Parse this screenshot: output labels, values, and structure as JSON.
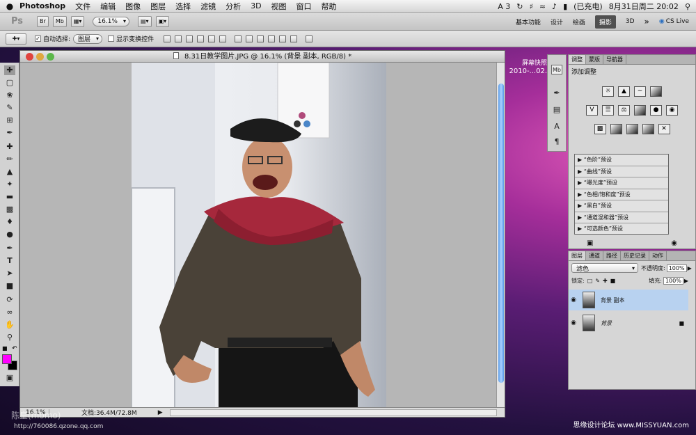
{
  "menubar": {
    "apple": "",
    "app": "Photoshop",
    "items": [
      "文件",
      "编辑",
      "图像",
      "图层",
      "选择",
      "滤镜",
      "分析",
      "3D",
      "视图",
      "窗口",
      "帮助"
    ],
    "status": {
      "a3": "A 3",
      "battery": "(已充电)",
      "datetime": "8月31日周二  20:02"
    }
  },
  "appbar": {
    "ps": "Ps",
    "br": "Br",
    "mb": "Mb",
    "zoom": "16.1%",
    "workspaces": [
      "基本功能",
      "设计",
      "绘画",
      "摄影",
      "3D"
    ],
    "active_workspace": "摄影",
    "more": "»",
    "cslive": "CS Live"
  },
  "options": {
    "auto_select_label": "自动选择:",
    "auto_select_value": "图层",
    "show_transform": "显示变换控件"
  },
  "document": {
    "title": "8.31日教学图片.JPG @ 16.1% (背景 副本, RGB/8) *",
    "zoom": "16.1%",
    "docsize": "文档:36.4M/72.8M"
  },
  "desktop": {
    "label_line1": "屏幕快照",
    "label_line2": "2010-...02."
  },
  "panels": {
    "adjust_tabs": [
      "调整",
      "蒙版",
      "导航器"
    ],
    "add_adjust": "添加调整",
    "presets": [
      "“色阶”预设",
      "“曲线”预设",
      "“曝光度”预设",
      "“色相/饱和度”预设",
      "“黑白”预设",
      "“通道混和器”预设",
      "“可选颜色”预设"
    ],
    "layer_tabs": [
      "图层",
      "通道",
      "路径",
      "历史记录",
      "动作"
    ],
    "blend_mode": "滤色",
    "opacity_label": "不透明度:",
    "opacity": "100%",
    "lock_label": "锁定:",
    "fill_label": "填充:",
    "fill": "100%",
    "layers": [
      {
        "name": "背景 副本",
        "selected": true
      },
      {
        "name": "背景",
        "selected": false
      }
    ]
  },
  "footer": {
    "left": "http://760086.qzone.qq.com",
    "right": "思缘设计论坛 www.MISSYUAN.com",
    "watermark": "陈皇(momo)"
  },
  "colors": {
    "foreground": "#ff00ff",
    "background": "#000000",
    "accent": "#3a8fe8"
  }
}
